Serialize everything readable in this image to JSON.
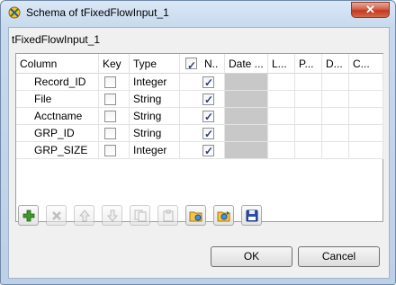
{
  "window": {
    "title": "Schema of tFixedFlowInput_1",
    "close_label": "✕"
  },
  "schema_name": "tFixedFlowInput_1",
  "table": {
    "columns": [
      "Column",
      "Key",
      "Type",
      "N..",
      "Date ...",
      "L...",
      "P...",
      "D...",
      "C..."
    ],
    "rows": [
      {
        "column": "Record_ID",
        "key": false,
        "type": "Integer",
        "nullable": true
      },
      {
        "column": "File",
        "key": false,
        "type": "String",
        "nullable": true
      },
      {
        "column": "Acctname",
        "key": false,
        "type": "String",
        "nullable": true
      },
      {
        "column": "GRP_ID",
        "key": false,
        "type": "String",
        "nullable": true
      },
      {
        "column": "GRP_SIZE",
        "key": false,
        "type": "Integer",
        "nullable": true
      }
    ]
  },
  "toolbar": {
    "buttons": [
      {
        "icon": "add-icon",
        "enabled": true
      },
      {
        "icon": "delete-icon",
        "enabled": false
      },
      {
        "icon": "move-up-icon",
        "enabled": false
      },
      {
        "icon": "move-down-icon",
        "enabled": false
      },
      {
        "icon": "copy-icon",
        "enabled": false
      },
      {
        "icon": "paste-icon",
        "enabled": false
      },
      {
        "icon": "import-icon",
        "enabled": true
      },
      {
        "icon": "export-icon",
        "enabled": true
      },
      {
        "icon": "save-icon",
        "enabled": true
      }
    ]
  },
  "buttons": {
    "ok": "OK",
    "cancel": "Cancel"
  },
  "colors": {
    "accent": "#2b3f73",
    "add_green": "#3a9a2a",
    "save_blue": "#2a4fb0"
  }
}
